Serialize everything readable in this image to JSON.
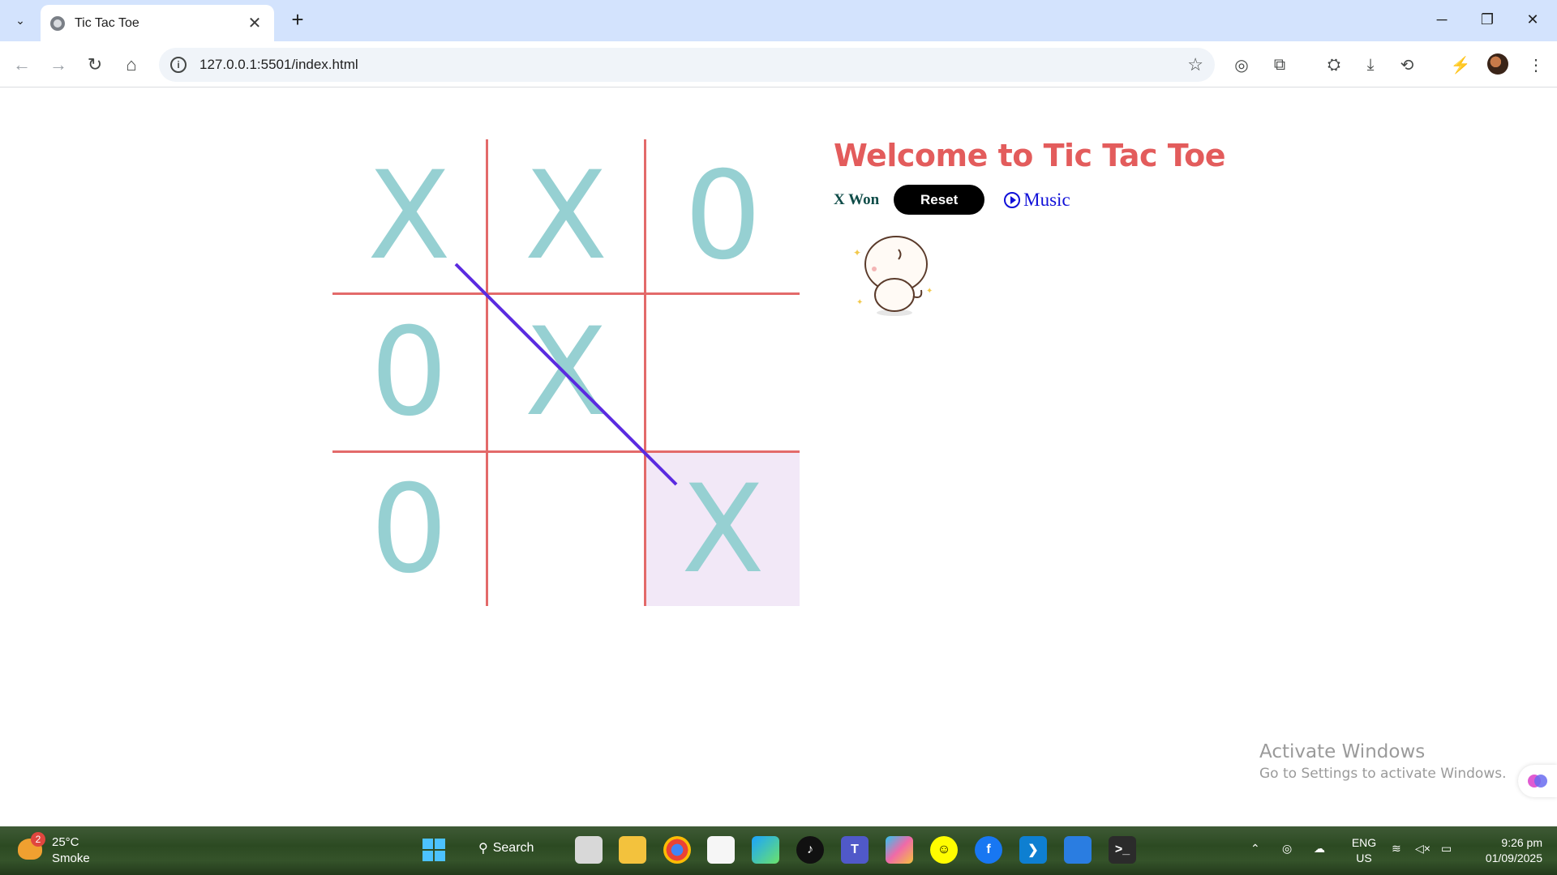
{
  "browser": {
    "tab_title": "Tic Tac Toe",
    "url": "127.0.0.1:5501/index.html",
    "new_tab_symbol": "+",
    "tab_close_symbol": "✕"
  },
  "game": {
    "title": "Welcome to Tic Tac Toe",
    "status": "X Won",
    "reset_label": "Reset",
    "music_label": "Music",
    "board": [
      [
        "X",
        "X",
        "0"
      ],
      [
        "0",
        "X",
        ""
      ],
      [
        "0",
        "",
        "X"
      ]
    ],
    "colors": {
      "mark": "#96d0d2",
      "grid": "#e36a6a",
      "win_line": "#5b2be0",
      "title": "#e35c5c",
      "highlight": "#f2e8f7"
    }
  },
  "watermark": {
    "title": "Activate Windows",
    "subtitle": "Go to Settings to activate Windows."
  },
  "taskbar": {
    "weather_temp": "25°C",
    "weather_desc": "Smoke",
    "weather_badge": "2",
    "search_label": "Search",
    "lang_line1": "ENG",
    "lang_line2": "US",
    "time": "9:26 pm",
    "date": "01/09/2025"
  }
}
